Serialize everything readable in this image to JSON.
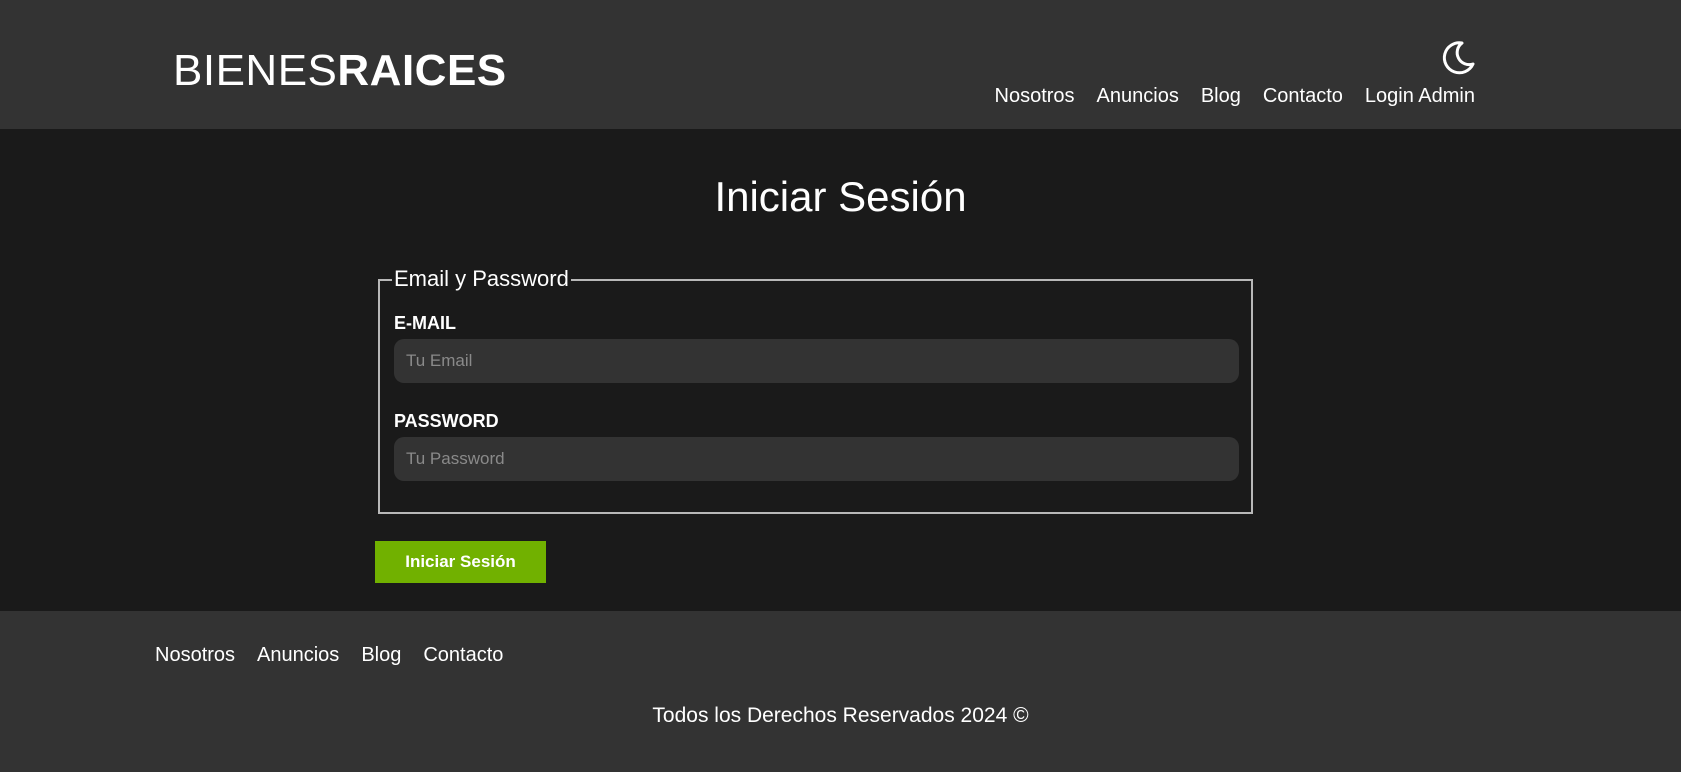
{
  "header": {
    "logo_light": "BIENES",
    "logo_bold": "RAICES",
    "theme_toggle_icon": "moon-icon",
    "nav": [
      {
        "label": "Nosotros"
      },
      {
        "label": "Anuncios"
      },
      {
        "label": "Blog"
      },
      {
        "label": "Contacto"
      },
      {
        "label": "Login Admin"
      }
    ]
  },
  "main": {
    "title": "Iniciar Sesión",
    "fieldset_legend": "Email y Password",
    "email": {
      "label": "E-MAIL",
      "placeholder": "Tu Email",
      "value": ""
    },
    "password": {
      "label": "PASSWORD",
      "placeholder": "Tu Password",
      "value": ""
    },
    "submit_label": "Iniciar Sesión"
  },
  "footer": {
    "nav": [
      {
        "label": "Nosotros"
      },
      {
        "label": "Anuncios"
      },
      {
        "label": "Blog"
      },
      {
        "label": "Contacto"
      }
    ],
    "copyright": "Todos los Derechos Reservados 2024 ©"
  },
  "colors": {
    "header_bg": "#333333",
    "body_bg": "#1a1a1a",
    "input_bg": "#333333",
    "button_bg": "#71b100",
    "text": "#ffffff"
  }
}
